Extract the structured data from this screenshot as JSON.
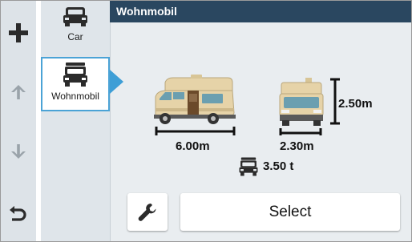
{
  "header": {
    "title": "Wohnmobil"
  },
  "nav": {
    "icons": [
      "plus-icon",
      "arrow-up-icon",
      "arrow-down-icon",
      "back-icon"
    ]
  },
  "profiles": [
    {
      "label": "Car",
      "icon": "car-icon",
      "selected": false
    },
    {
      "label": "Wohnmobil",
      "icon": "camper-icon",
      "selected": true
    }
  ],
  "dimensions": {
    "length": "6.00m",
    "width": "2.30m",
    "height": "2.50m",
    "weight": "3.50 t"
  },
  "actions": {
    "settings_icon": "wrench-icon",
    "select_label": "Select"
  },
  "colors": {
    "title_bar": "#2a4760",
    "accent": "#3d9ed6",
    "vehicle_body": "#e6d3a8"
  }
}
